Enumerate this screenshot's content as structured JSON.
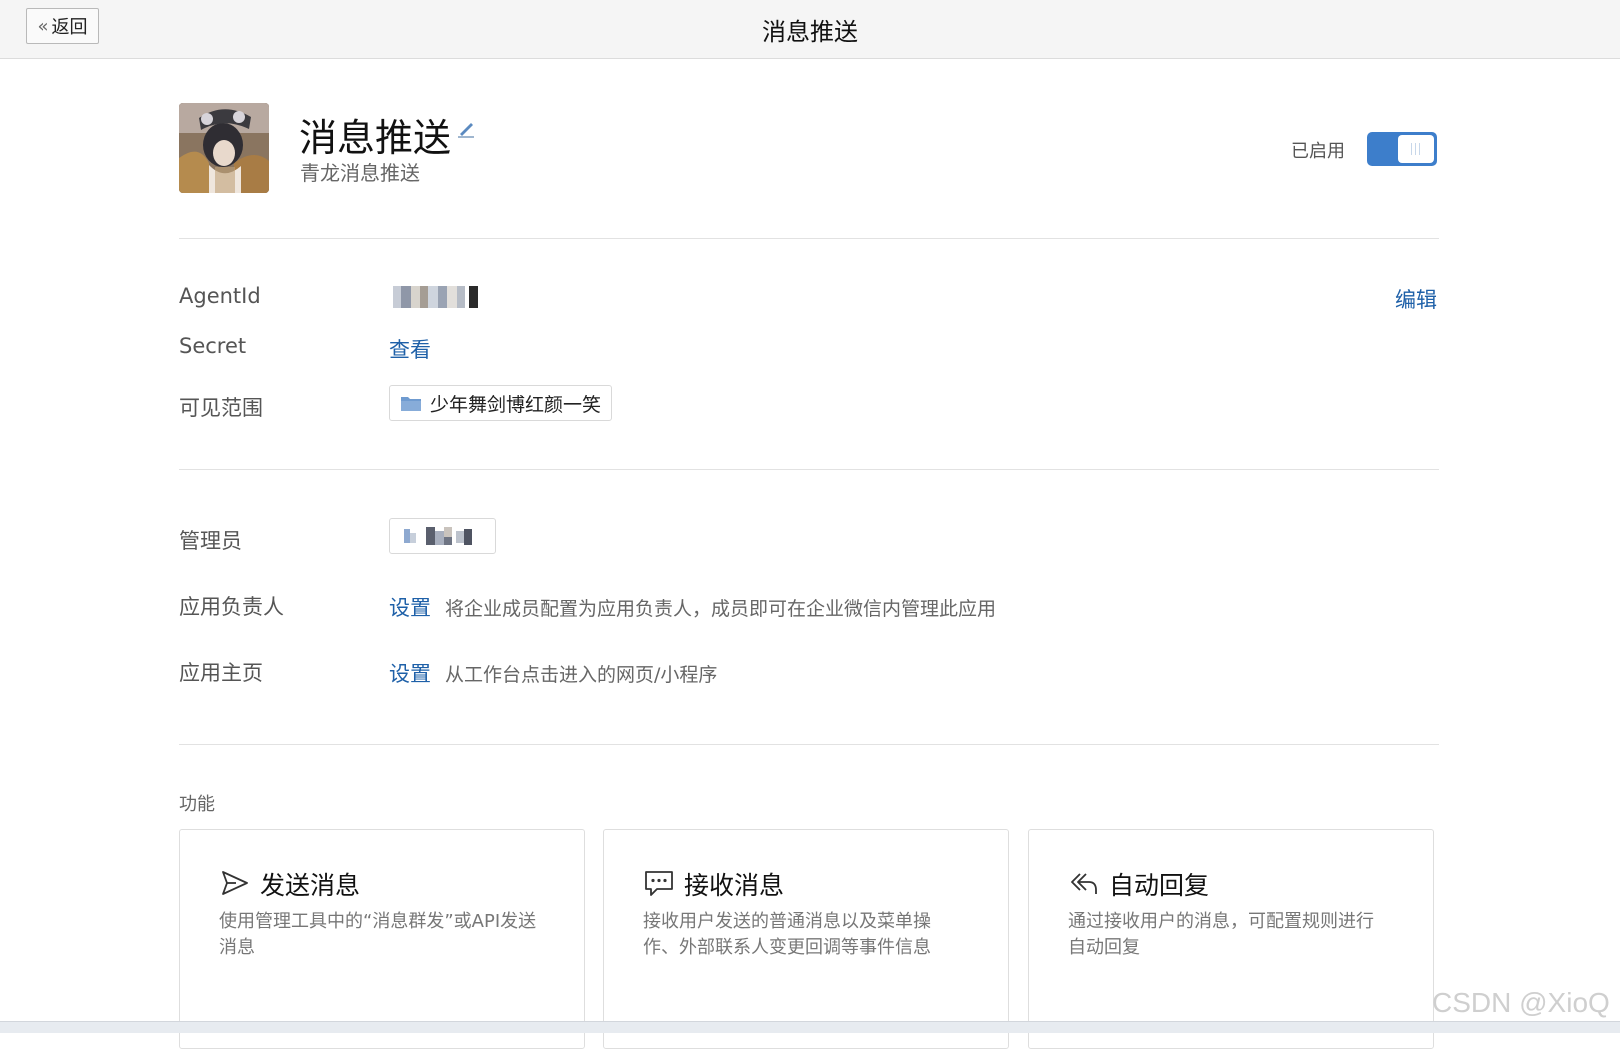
{
  "topbar": {
    "back_label": "返回",
    "title": "消息推送"
  },
  "app": {
    "name": "消息推送",
    "description": "青龙消息推送",
    "status_label": "已启用",
    "enabled": true
  },
  "details": {
    "agentid_label": "AgentId",
    "edit_label": "编辑",
    "secret_label": "Secret",
    "secret_link": "查看",
    "visibility_label": "可见范围",
    "visibility_value": "少年舞剑博红颜一笑"
  },
  "management": {
    "admin_label": "管理员",
    "owner_label": "应用负责人",
    "owner_link": "设置",
    "owner_hint": "将企业成员配置为应用负责人，成员即可在企业微信内管理此应用",
    "homepage_label": "应用主页",
    "homepage_link": "设置",
    "homepage_hint": "从工作台点击进入的网页/小程序"
  },
  "features": {
    "section_title": "功能",
    "cards": [
      {
        "icon": "send-icon",
        "title": "发送消息",
        "desc": "使用管理工具中的“消息群发”或API发送消息"
      },
      {
        "icon": "chat-bubble-icon",
        "title": "接收消息",
        "desc": "接收用户发送的普通消息以及菜单操作、外部联系人变更回调等事件信息"
      },
      {
        "icon": "reply-icon",
        "title": "自动回复",
        "desc": "通过接收用户的消息，可配置规则进行自动回复"
      }
    ]
  },
  "watermark": "CSDN @XioQ",
  "colors": {
    "accent": "#3d7ecb",
    "link": "#1e60a8",
    "folder": "#6f9bd0"
  }
}
